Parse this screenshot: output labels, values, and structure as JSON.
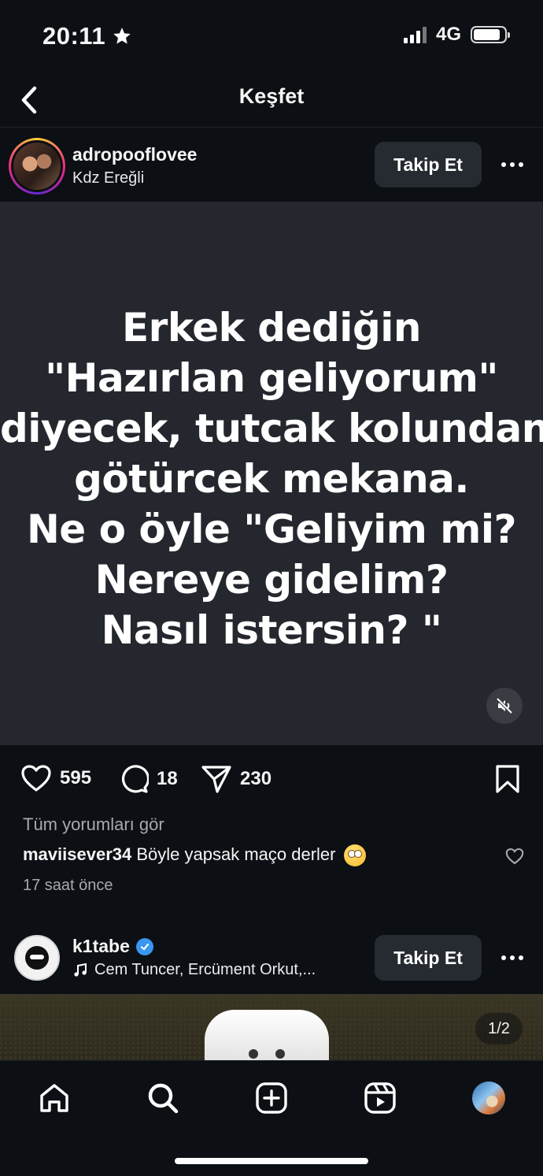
{
  "status_bar": {
    "time": "20:11",
    "network": "4G"
  },
  "header": {
    "title": "Keşfet"
  },
  "post": {
    "username": "adropooflovee",
    "location": "Kdz Ereğli",
    "follow_label": "Takip Et",
    "media_text_lines": [
      "Erkek dediğin",
      "\"Hazırlan geliyorum\"",
      "diyecek, tutcak kolundan",
      "götürcek mekana.",
      "Ne o öyle \"Geliyim mi?",
      "Nereye gidelim?",
      "Nasıl istersin? \""
    ],
    "likes": "595",
    "comments": "18",
    "shares": "230",
    "view_all_comments": "Tüm yorumları gör",
    "top_comment": {
      "user": "maviisever34",
      "text": "Böyle yapsak maço derler"
    },
    "time_ago": "17 saat önce"
  },
  "post2": {
    "username": "k1tabe",
    "music": "Cem Tuncer, Ercüment Orkut,...",
    "follow_label": "Takip Et",
    "pager": "1/2"
  },
  "icons": {
    "status": [
      "star-icon",
      "signal-icon",
      "battery-icon"
    ],
    "nav": [
      "back-icon"
    ],
    "actions": [
      "heart-icon",
      "comment-icon",
      "share-icon",
      "bookmark-icon",
      "mute-icon"
    ],
    "tabs": [
      "home-icon",
      "search-icon",
      "add-icon",
      "reels-icon",
      "profile-avatar"
    ]
  },
  "colors": {
    "background": "#0c0f14",
    "media_bg": "#25272e",
    "button_bg": "#262a31",
    "verified": "#3897f0",
    "muted_text": "#a7a9ad"
  }
}
